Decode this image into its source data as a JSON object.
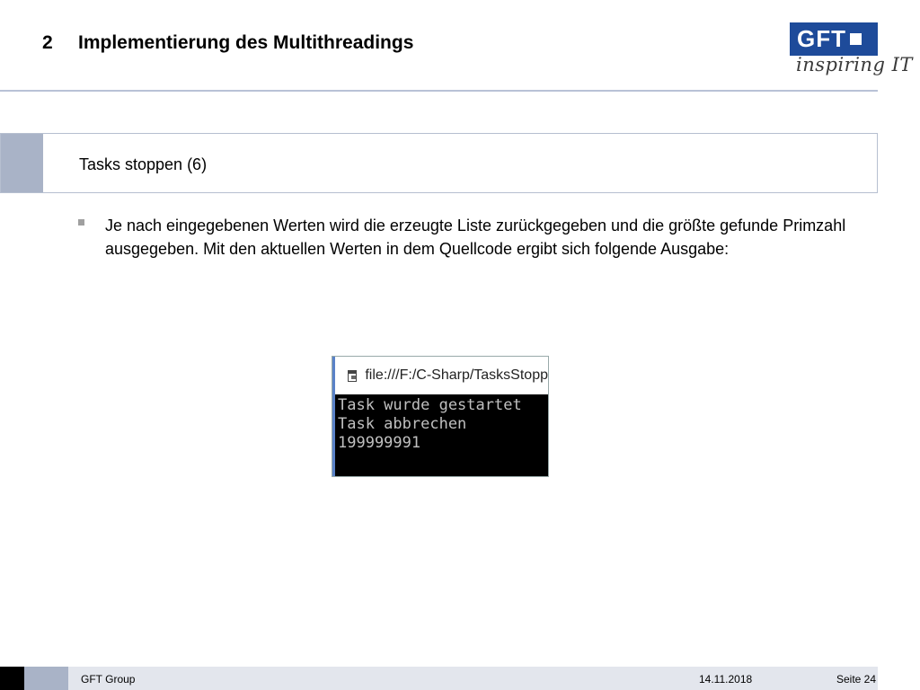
{
  "header": {
    "section_number": "2",
    "title": "Implementierung des Multithreadings"
  },
  "logo": {
    "brand": "GFT",
    "tagline": "inspiring IT",
    "colors": {
      "brand_blue": "#1e4b9a"
    }
  },
  "section": {
    "title": "Tasks stoppen (6)"
  },
  "bullets": [
    {
      "text": "Je nach eingegebenen Werten wird die erzeugte Liste zurückgegeben und die größte gefunde Primzahl ausgegeben. Mit den aktuellen Werten in dem Quellcode ergibt sich folgende Ausgabe:"
    }
  ],
  "console": {
    "title": "file:///F:/C-Sharp/TasksStopp",
    "lines": [
      "Task wurde gestartet",
      "Task abbrechen",
      "199999991"
    ]
  },
  "footer": {
    "company": "GFT Group",
    "date": "14.11.2018",
    "page": "Seite 24"
  }
}
